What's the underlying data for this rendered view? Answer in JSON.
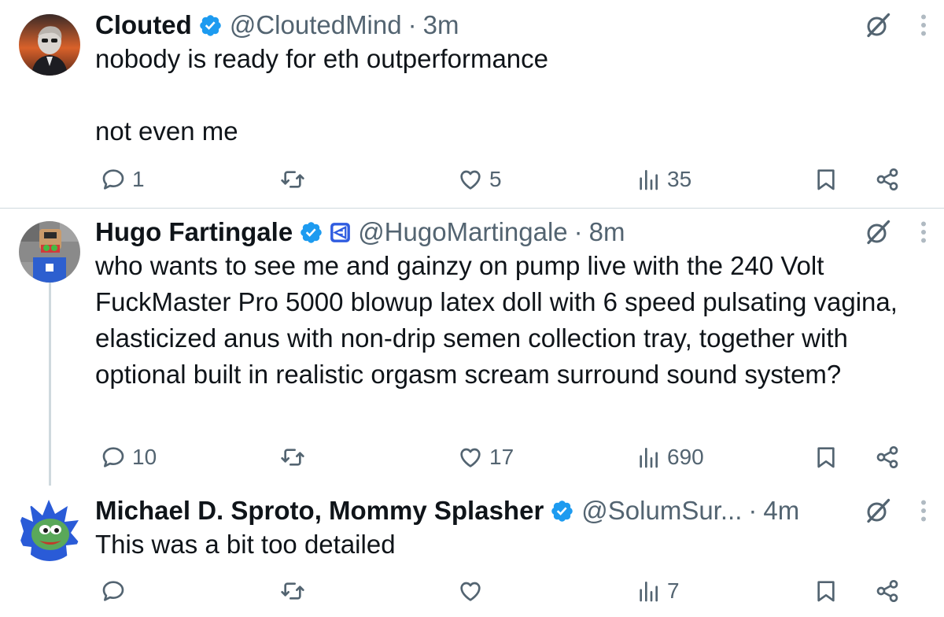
{
  "colors": {
    "text": "#0f1419",
    "secondary": "#536471",
    "verified_blue": "#1d9bf0",
    "divider": "#cfd9de"
  },
  "tweets": [
    {
      "name": "Clouted",
      "handle": "@CloutedMind",
      "separator": "·",
      "time": "3m",
      "text": "nobody is ready for eth outperformance\n\nnot even me",
      "replies": "1",
      "reposts": "",
      "likes": "5",
      "views": "35",
      "icons": [
        "verified-badge-icon",
        "grok-icon",
        "more-icon",
        "reply-icon",
        "repost-icon",
        "like-icon",
        "views-icon",
        "bookmark-icon",
        "share-icon"
      ]
    },
    {
      "name": "Hugo Fartingale",
      "handle": "@HugoMartingale",
      "separator": "·",
      "time": "8m",
      "text": "who wants to see me and gainzy on pump live with the 240 Volt FuckMaster Pro 5000 blowup latex doll with 6 speed pulsating vagina, elasticized anus with non-drip semen collection tray, together with optional built in realistic orgasm scream surround sound system?",
      "replies": "10",
      "reposts": "",
      "likes": "17",
      "views": "690",
      "icons": [
        "verified-badge-icon",
        "affiliate-badge-icon",
        "grok-icon",
        "more-icon",
        "reply-icon",
        "repost-icon",
        "like-icon",
        "views-icon",
        "bookmark-icon",
        "share-icon"
      ]
    },
    {
      "name": "Michael D. Sproto, Mommy Splasher",
      "handle": "@SolumSur...",
      "separator": "·",
      "time": "4m",
      "text": "This was a bit too detailed",
      "replies": "",
      "reposts": "",
      "likes": "",
      "views": "7",
      "icons": [
        "verified-badge-icon",
        "grok-icon",
        "more-icon",
        "reply-icon",
        "repost-icon",
        "like-icon",
        "views-icon",
        "bookmark-icon",
        "share-icon"
      ]
    }
  ]
}
